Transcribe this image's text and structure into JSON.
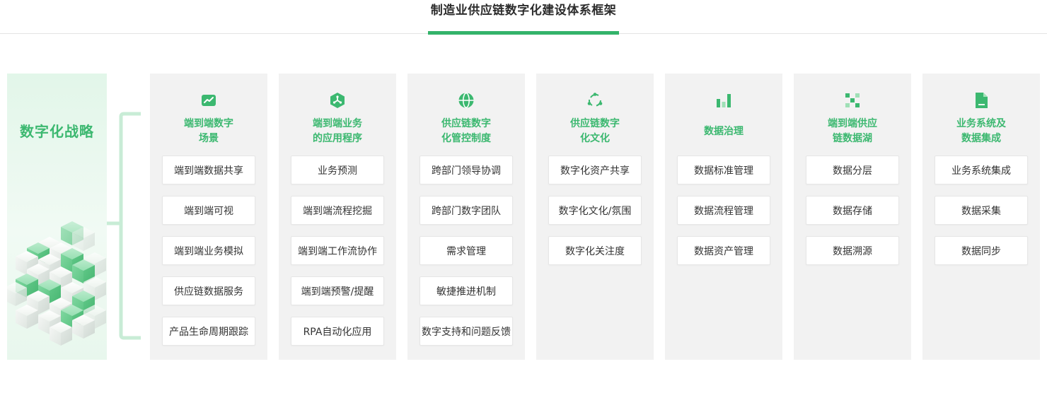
{
  "tab": {
    "title": "制造业供应链数字化建设体系框架"
  },
  "strategy": {
    "title": "数字化战略"
  },
  "colors": {
    "accent": "#33b36a",
    "title_green": "#3cb870",
    "column_bg": "#f2f2f2"
  },
  "columns": [
    {
      "icon": "line-chart-icon",
      "title": "端到端数字\n场景",
      "items": [
        "端到端数据共享",
        "端到端可视",
        "端到端业务模拟",
        "供应链数据服务",
        "产品生命周期跟踪"
      ]
    },
    {
      "icon": "hexagon-network-icon",
      "title": "端到端业务\n的应用程序",
      "items": [
        "业务预测",
        "端到端流程挖掘",
        "端到端工作流协作",
        "端到端预警/提醒",
        "RPA自动化应用"
      ]
    },
    {
      "icon": "globe-icon",
      "title": "供应链数字\n化管控制度",
      "items": [
        "跨部门领导协调",
        "跨部门数字团队",
        "需求管理",
        "敏捷推进机制",
        "数字支持和问题反馈"
      ]
    },
    {
      "icon": "cycle-icon",
      "title": "供应链数字\n化文化",
      "items": [
        "数字化资产共享",
        "数字化文化/氛围",
        "数字化关注度"
      ]
    },
    {
      "icon": "bar-chart-icon",
      "title": "数据治理",
      "items": [
        "数据标准管理",
        "数据流程管理",
        "数据资产管理"
      ]
    },
    {
      "icon": "data-lake-icon",
      "title": "端到端供应\n链数据湖",
      "items": [
        "数据分层",
        "数据存储",
        "数据溯源"
      ]
    },
    {
      "icon": "document-icon",
      "title": "业务系统及\n数据集成",
      "items": [
        "业务系统集成",
        "数据采集",
        "数据同步"
      ]
    }
  ]
}
